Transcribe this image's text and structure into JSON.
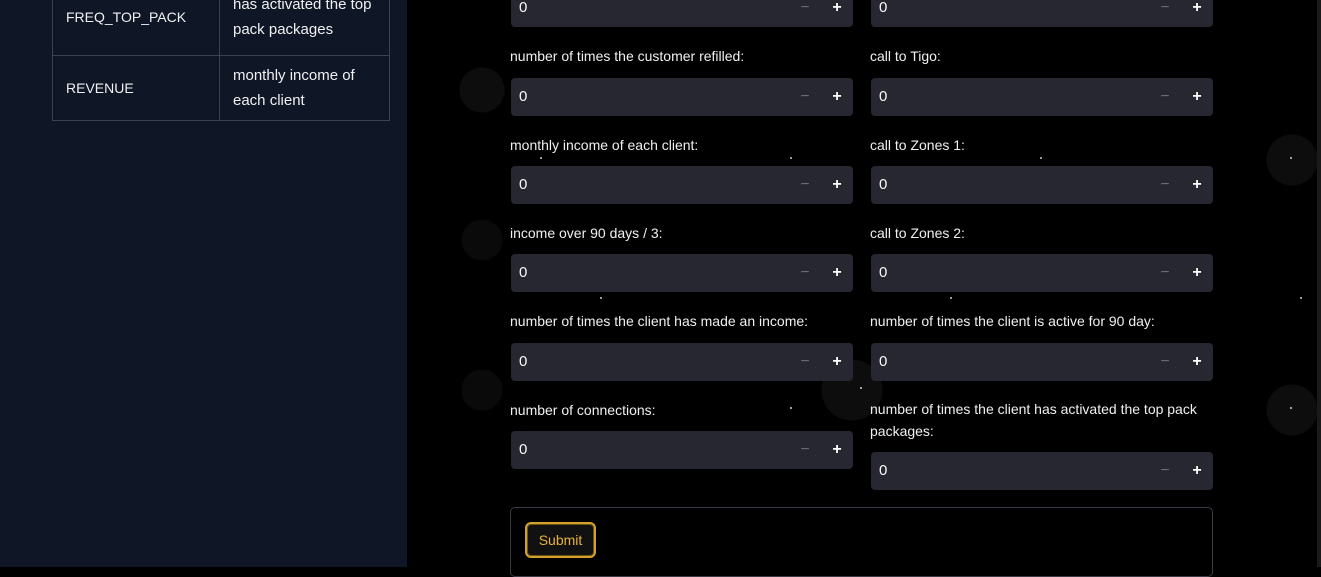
{
  "sidebar": {
    "table": {
      "rows": [
        {
          "key": "FREQ_TOP_PACK",
          "value": "has activated the top pack packages"
        },
        {
          "key": "REVENUE",
          "value": "monthly income of each client"
        }
      ]
    }
  },
  "form": {
    "top_row": {
      "left_value": "0",
      "right_value": "0"
    },
    "fields": [
      {
        "label": "number of times the customer refilled:",
        "value": "0"
      },
      {
        "label": "call to Tigo:",
        "value": "0"
      },
      {
        "label": "monthly income of each client:",
        "value": "0"
      },
      {
        "label": "call to Zones 1:",
        "value": "0"
      },
      {
        "label": "income over 90 days / 3:",
        "value": "0"
      },
      {
        "label": "call to Zones 2:",
        "value": "0"
      },
      {
        "label": "number of times the client has made an income:",
        "value": "0"
      },
      {
        "label": "number of times the client is active for 90 day:",
        "value": "0"
      },
      {
        "label": "number of connections:",
        "value": "0"
      },
      {
        "label": "number of times the client has activated the top pack packages:",
        "value": "0"
      }
    ],
    "minus_symbol": "−",
    "plus_symbol": "+",
    "submit_label": "Submit"
  },
  "colors": {
    "accent": "#e9b33c",
    "input_bg": "#262730",
    "sidebar_bg": "#0f1626"
  }
}
